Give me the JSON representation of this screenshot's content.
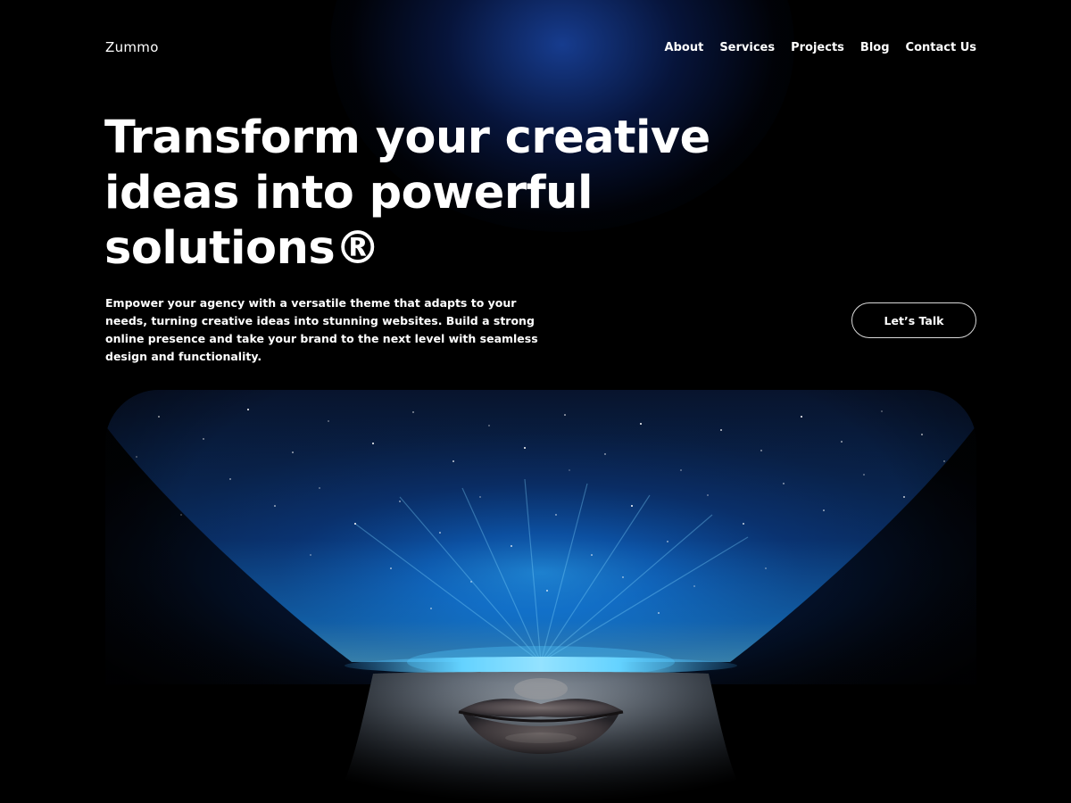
{
  "header": {
    "logo": "Zummo",
    "nav": [
      {
        "label": "About"
      },
      {
        "label": "Services"
      },
      {
        "label": "Projects"
      },
      {
        "label": "Blog"
      },
      {
        "label": "Contact Us"
      }
    ]
  },
  "hero": {
    "headline": "Transform your creative ideas into powerful solutions®",
    "description": "Empower your agency with a versatile theme that adapts to your needs, turning creative ideas into stunning websites. Build a strong online presence and take your brand to the next level with seamless design and functionality.",
    "cta_label": "Let’s Talk",
    "image_subject": "starry-sky-over-face-with-blue-glow"
  },
  "colors": {
    "background": "#000000",
    "text": "#ffffff",
    "accent_glow": "#1e8fff"
  }
}
